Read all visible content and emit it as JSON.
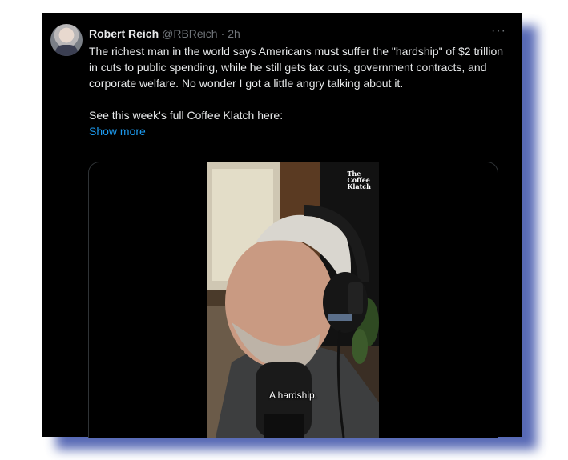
{
  "tweet": {
    "author_name": "Robert Reich",
    "author_handle": "@RBReich",
    "separator": "·",
    "time": "2h",
    "more_icon": "···",
    "text_paragraph_1": "The richest man in the world says Americans must suffer the \"hardship\" of $2 trillion in cuts to public spending, while he still gets tax cuts, government contracts, and corporate welfare. No wonder I got a little angry talking about it.",
    "text_paragraph_2": "See this week's full Coffee Klatch here:",
    "show_more": "Show more"
  },
  "video": {
    "watermark_line1": "The",
    "watermark_line2": "Coffee",
    "watermark_line3": "Klatch",
    "caption": "A hardship."
  },
  "colors": {
    "background": "#000000",
    "link": "#1d9bf0",
    "muted": "#71767b",
    "text": "#e7e9ea",
    "frame_shadow": "#3a4fa8"
  }
}
